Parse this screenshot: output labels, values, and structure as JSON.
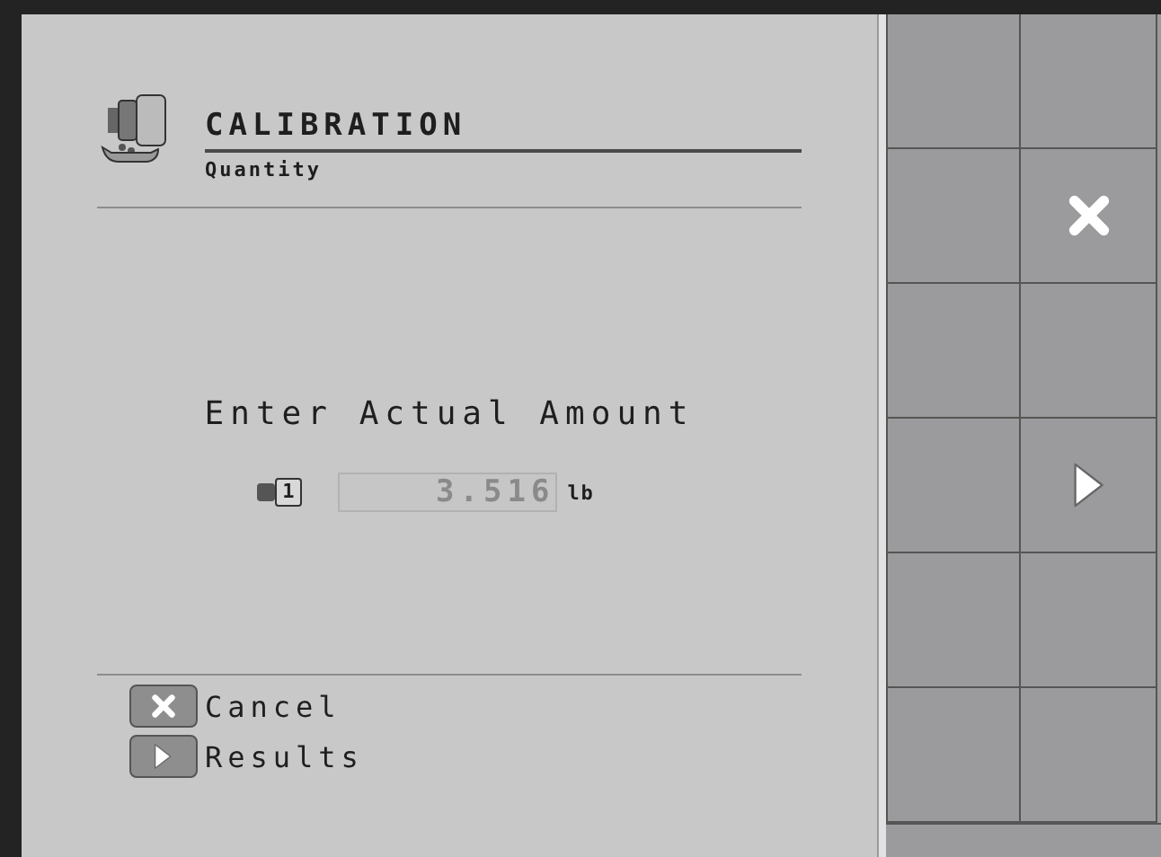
{
  "header": {
    "title": "CALIBRATION",
    "subtitle": "Quantity"
  },
  "prompt": "Enter Actual Amount",
  "entry": {
    "meter_number": "1",
    "value": "3.516",
    "unit": "lb"
  },
  "legend": [
    {
      "kind": "cancel",
      "label": "Cancel"
    },
    {
      "kind": "next",
      "label": "Results"
    }
  ],
  "softkeys": [
    {
      "kind": "blank"
    },
    {
      "kind": "blank"
    },
    {
      "kind": "blank"
    },
    {
      "kind": "cancel"
    },
    {
      "kind": "blank"
    },
    {
      "kind": "blank"
    },
    {
      "kind": "blank"
    },
    {
      "kind": "next"
    },
    {
      "kind": "blank"
    },
    {
      "kind": "blank"
    },
    {
      "kind": "blank"
    },
    {
      "kind": "blank"
    }
  ]
}
